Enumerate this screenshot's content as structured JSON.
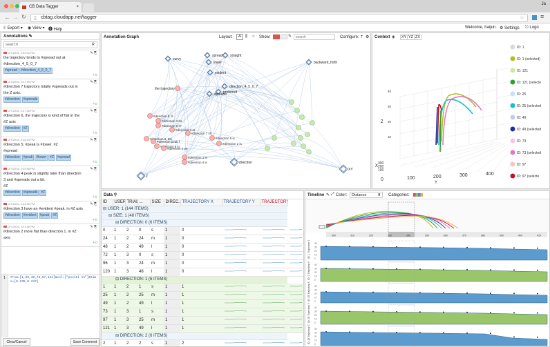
{
  "browser": {
    "tab_title": "CB Data Tagger",
    "url": "cbtag.cloudapp.net/tagger",
    "user_initials": "Ja"
  },
  "menu": {
    "export": "Export",
    "view": "View",
    "help": "Help",
    "welcome": "Welcome, haijun.",
    "settings": "Settings",
    "logout": "Logo"
  },
  "annotations": {
    "title": "Annotations",
    "search_placeholder": "search",
    "items": [
      {
        "meta": "2/7/2016, 2:53:01 PM",
        "lines": [
          "the trajectory tends to #spread out at",
          "#direction_4_5_0_7"
        ],
        "tags": [
          "#spread",
          "#direction_4_5_0_7"
        ]
      },
      {
        "meta": "2/7/2016, 2:47:00 PM",
        "lines": [
          "#direction 7 trajectory totally #spreads out in",
          "the Z axis."
        ],
        "tags": [
          "#direction",
          "#spreads"
        ]
      },
      {
        "meta": "2/7/2016, 2:47:18 PM",
        "lines": [
          "#direction 6, the trajectory is kind of flat in the",
          "#Z axis"
        ],
        "tags": [
          "#direction",
          "#Z"
        ]
      },
      {
        "meta": "2/7/2016, 2:46:13 PM",
        "lines": [
          "#direction 5, #peak is #lower. #Z",
          "#spread"
        ],
        "tags": [
          "#direction",
          "#peak",
          "#lower",
          "#Z",
          "#spread"
        ]
      },
      {
        "meta": "2/7/2016, 2:45:08 PM",
        "lines": [
          "#direction 4 peak is slightly later than direction",
          "3 and #spreads out a bit.",
          "#Z"
        ],
        "tags": [
          "#direction",
          "#spreads",
          "#Z"
        ]
      },
      {
        "meta": "2/7/2016, 2:43:00 PM",
        "lines": [
          "#direction 3 have an #evident #peak. in #Z axis"
        ],
        "tags": [
          "#direction",
          "#evident",
          "#peak",
          "#Z"
        ]
      },
      {
        "meta": "2/7/2016, 2:41:00 PM",
        "lines": [
          "#direction 2 more flat than direction 1. in #Z",
          "axis"
        ],
        "tags": []
      }
    ],
    "editor_line_no": "1",
    "editor_text": "#row=[1,25,49,73,97,121]&col=[\"positi on\"]&time=[0.235,0.347]",
    "clear_label": "Clear/Cancel",
    "save_label": "Save Comment"
  },
  "graph": {
    "title": "Annotation Graph",
    "layout_label": "Layout:",
    "show_label": "Show:",
    "search_placeholder": "search",
    "configure_label": "Configure:",
    "tag_nodes": [
      "curvy",
      "spread",
      "lower",
      "evident",
      "straight",
      "backward_forth",
      "direction_4_5_0_7",
      "preferred",
      "spreads",
      "direction",
      "XY",
      "Z",
      "the trajectory"
    ],
    "ann_nodes": [
      "#direction 5, #...",
      "#direction 3 ha",
      "#direction 0 re",
      "#direction 1 re",
      "#direction 7 sh",
      "#direction 6, the",
      "#direction peak f",
      "#direction 5 lo",
      "#direction 4 pe",
      "#direction 5 is",
      "#direction 2 is",
      "#direction 1 is",
      "#direction 4 is"
    ]
  },
  "context": {
    "title": "Context",
    "tabs": [
      "XY",
      "YZ",
      "ZX"
    ],
    "axis_x": "X",
    "axis_y": "Y",
    "axis_z": "Z",
    "legend": [
      {
        "label": "ID: 1",
        "color": "#d9d9d9"
      },
      {
        "label": "ID: 1 (selected)",
        "color": "#b5bd1d"
      },
      {
        "label": "ID: 121",
        "color": "#c7e9a0"
      },
      {
        "label": "ID: 121 (selecte",
        "color": "#2ca02c"
      },
      {
        "label": "ID: 25",
        "color": "#c6e3f5"
      },
      {
        "label": "ID: 25 (selected",
        "color": "#17becf"
      },
      {
        "label": "ID: 49",
        "color": "#c5cbf0"
      },
      {
        "label": "ID: 49 (selected",
        "color": "#1f2f9f"
      },
      {
        "label": "ID: 73",
        "color": "#f7c6e6"
      },
      {
        "label": "ID: 73 (selected",
        "color": "#e377c2"
      },
      {
        "label": "ID: 97",
        "color": "#f4c7c3"
      },
      {
        "label": "ID: 97 (selecte",
        "color": "#c0102a"
      }
    ],
    "ticks_x": [
      "0",
      "100",
      "200",
      "300",
      "400"
    ],
    "ticks_y": [
      "100",
      "200",
      "300"
    ],
    "ticks_z": [
      "10",
      "20",
      "30",
      "40"
    ]
  },
  "data": {
    "title": "Data",
    "columns": [
      "ID",
      "USER",
      "TRIAL",
      "...",
      "SIZE",
      "DIREC...",
      "TRAJECTORY X",
      "TRAJECTORY Y",
      "TRAJECTORY"
    ],
    "group_user": "USER: 1 (144 ITEMS)",
    "group_size": "SIZE: 1 (48 ITEMS)",
    "groups": [
      {
        "label": "DIRECTION: 0 (6 ITEMS)",
        "rows": [
          [
            "0",
            "1",
            "2",
            "0",
            "s",
            "1",
            "0"
          ],
          [
            "24",
            "1",
            "2",
            "24",
            "m",
            "1",
            "0"
          ],
          [
            "48",
            "1",
            "2",
            "49",
            "l",
            "1",
            "0"
          ],
          [
            "72",
            "1",
            "3",
            "0",
            "s",
            "1",
            "0"
          ],
          [
            "96",
            "1",
            "3",
            "24",
            "m",
            "1",
            "0"
          ],
          [
            "120",
            "1",
            "3",
            "48",
            "l",
            "1",
            "0"
          ]
        ]
      },
      {
        "label": "DIRECTION: 1 (6 ITEMS)",
        "rows": [
          [
            "1",
            "1",
            "2",
            "1",
            "s",
            "1",
            "1"
          ],
          [
            "25",
            "1",
            "2",
            "25",
            "m",
            "1",
            "1"
          ],
          [
            "49",
            "1",
            "2",
            "49",
            "l",
            "1",
            "1"
          ],
          [
            "73",
            "1",
            "3",
            "1",
            "s",
            "1",
            "1"
          ],
          [
            "97",
            "1",
            "3",
            "25",
            "m",
            "1",
            "1"
          ],
          [
            "121",
            "1",
            "3",
            "49",
            "l",
            "1",
            "1"
          ]
        ]
      },
      {
        "label": "DIRECTION: 2 (6 ITEMS)",
        "rows": [
          [
            "2",
            "1",
            "2",
            "2",
            "s",
            "1",
            "2"
          ],
          [
            "26",
            "1",
            "2",
            "26",
            "m",
            "1",
            "2"
          ]
        ]
      }
    ]
  },
  "timeline": {
    "title": "Timeline",
    "color_label": "Color:",
    "color_value": "Distance",
    "categories_label": "Categories:",
    "axis_ticks": [
      "300",
      "310",
      "320",
      "330",
      "340",
      "350",
      "360",
      "370",
      "380",
      "390",
      "400",
      "410"
    ],
    "rows": [
      {
        "label": "ID: 1 Trajectory X",
        "color": "#4a90c8"
      },
      {
        "label": "ID: 1 Trajectory Y",
        "color": "#8fc05a"
      },
      {
        "label": "ID: 25 Trajectory X",
        "color": "#4a90c8"
      },
      {
        "label": "ID: 25 Trajectory Y",
        "color": "#8fc05a"
      },
      {
        "label": "ID: 25 Trajectory Z",
        "color": "#4a90c8"
      }
    ],
    "row_ticks": [
      "40",
      "30",
      "20",
      "10",
      "0"
    ]
  }
}
